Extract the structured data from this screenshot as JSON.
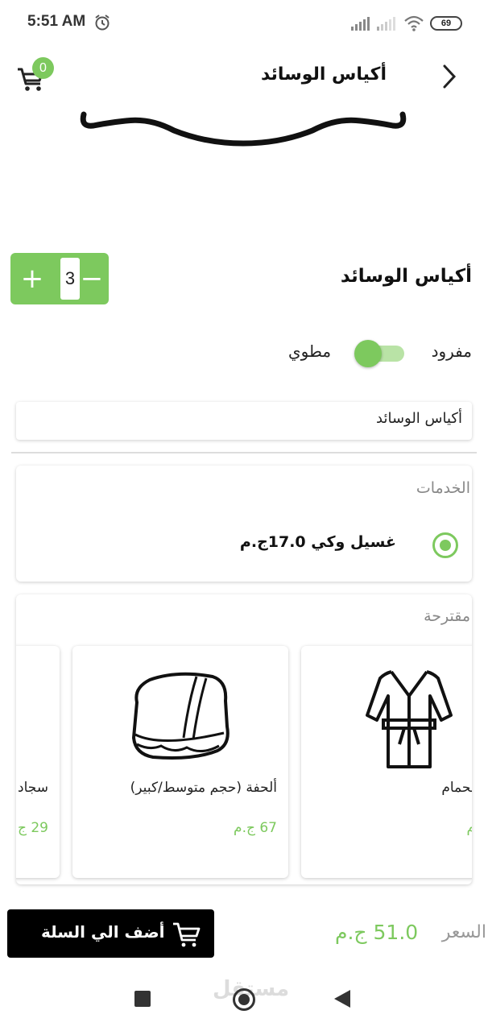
{
  "status_bar": {
    "time": "5:51 AM",
    "battery": "69",
    "icons": [
      "alarm-icon",
      "signal-icon",
      "signal-weak-icon",
      "wifi-icon",
      "battery-icon"
    ]
  },
  "app_bar": {
    "title": "أكياس الوسائد",
    "cart_count": "0",
    "icons": [
      "cart-icon",
      "chevron-right-icon"
    ]
  },
  "product": {
    "name": "أكياس الوسائد",
    "quantity": "3",
    "plus_symbol": "+",
    "minus_symbol": "−"
  },
  "fold_option": {
    "right_label": "مفرود",
    "left_label": "مطوي"
  },
  "name_field": {
    "value": "أكياس الوسائد"
  },
  "services": {
    "title": "الخدمات",
    "options": [
      {
        "label": "غسيل وكي 17.0ج.م",
        "selected": true
      }
    ]
  },
  "suggested": {
    "title": "مقترحة",
    "items": [
      {
        "name": "لحمام",
        "price": "م",
        "icon": "bathrobe-icon"
      },
      {
        "name": "ألحفة (حجم متوسط/كبير)",
        "price": "67 ج.م",
        "icon": "folded-blanket-icon"
      },
      {
        "name": "سجاد",
        "price": "29 ج",
        "icon": ""
      }
    ]
  },
  "footer": {
    "price_label": "السعر",
    "price_value": "51.0 ج.م",
    "add_to_cart": "أضف الي السلة"
  },
  "watermark": "مستقل",
  "colors": {
    "accent": "#7dc95e",
    "accent_light": "#b9e3a6",
    "button_dark": "#000000",
    "muted_text": "#888888"
  }
}
